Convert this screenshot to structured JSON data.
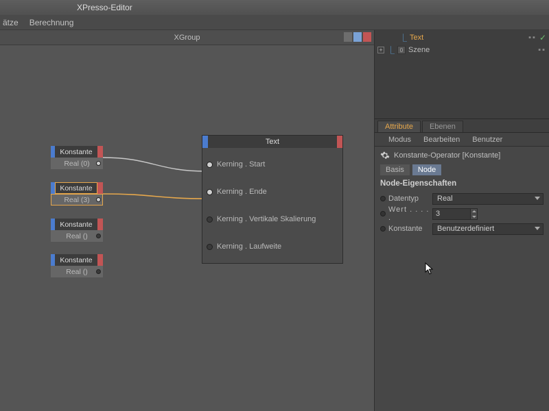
{
  "titlebar": {
    "title": "XPresso-Editor"
  },
  "menubar": {
    "items": [
      "ätze",
      "Berechnung"
    ]
  },
  "editor": {
    "group_title": "XGroup"
  },
  "nodes": {
    "const": [
      {
        "title": "Konstante",
        "value": "Real (0)"
      },
      {
        "title": "Konstante",
        "value": "Real (3)"
      },
      {
        "title": "Konstante",
        "value": "Real ()"
      },
      {
        "title": "Konstante",
        "value": "Real ()"
      }
    ],
    "text_node": {
      "title": "Text",
      "ports": [
        "Kerning . Start",
        "Kerning . Ende",
        "Kerning . Vertikale Skalierung",
        "Kerning . Laufweite"
      ]
    }
  },
  "obj_tree": {
    "rows": [
      {
        "name": "Text"
      },
      {
        "name": "Szene",
        "badge": "0"
      }
    ]
  },
  "attr": {
    "tabs": {
      "attribute": "Attribute",
      "ebenen": "Ebenen"
    },
    "menu": [
      "Modus",
      "Bearbeiten",
      "Benutzer"
    ],
    "header": "Konstante-Operator [Konstante]",
    "subtabs": {
      "basis": "Basis",
      "node": "Node"
    },
    "section": "Node-Eigenschaften",
    "rows": {
      "datentyp": {
        "label": "Datentyp",
        "value": "Real"
      },
      "wert": {
        "label": "Wert . . . . .",
        "value": "3"
      },
      "konstante": {
        "label": "Konstante",
        "value": "Benutzerdefiniert"
      }
    }
  }
}
